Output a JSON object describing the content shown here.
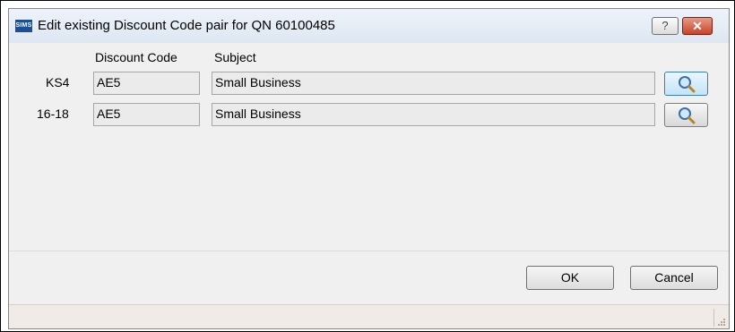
{
  "window": {
    "app_icon": "SIMS",
    "title": "Edit existing Discount Code pair for QN 60100485",
    "help_label": "?",
    "close_label": "✕"
  },
  "table": {
    "headers": {
      "discount_code": "Discount Code",
      "subject": "Subject"
    },
    "rows": [
      {
        "label": "KS4",
        "discount_code": "AE5",
        "subject": "Small Business"
      },
      {
        "label": "16-18",
        "discount_code": "AE5",
        "subject": "Small Business"
      }
    ]
  },
  "buttons": {
    "ok": "OK",
    "cancel": "Cancel"
  },
  "icons": {
    "lookup": "magnifier-icon"
  }
}
